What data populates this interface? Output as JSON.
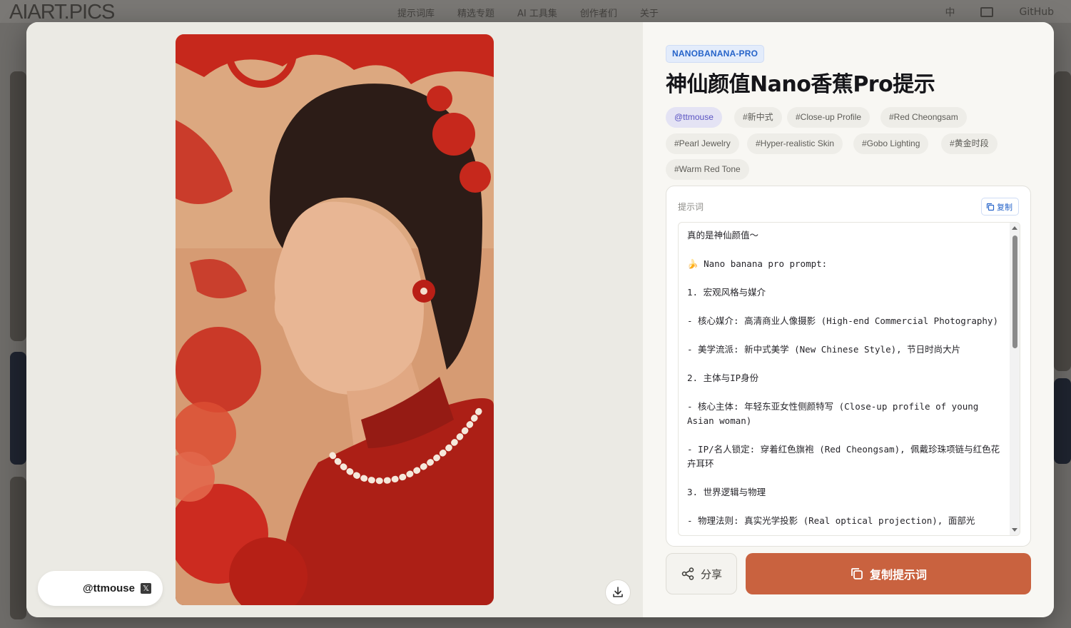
{
  "background": {
    "logo": "AIART.PICS",
    "nav": [
      "提示词库",
      "精选专题",
      "AI 工具集",
      "创作者们",
      "关于"
    ],
    "lang": "中",
    "github": "GitHub"
  },
  "modal": {
    "author_handle": "@ttmouse",
    "x_icon": "x-logo",
    "category": "NANOBANANA-PRO",
    "title": "神仙颜值Nano香蕉Pro提示",
    "tags": [
      "@ttmouse",
      "#新中式",
      "#Close-up Profile",
      "#Red Cheongsam",
      "#Pearl Jewelry",
      "#Hyper-realistic Skin",
      "#Gobo Lighting",
      "#黄金时段",
      "#Warm Red Tone"
    ],
    "prompt": {
      "label": "提示词",
      "copy_label": "复制",
      "text": "真的是神仙颜值～\n\n🍌 Nano banana pro prompt:\n\n1. 宏观风格与媒介\n\n- 核心媒介: 高清商业人像摄影 (High-end Commercial Photography)\n\n- 美学流派: 新中式美学 (New Chinese Style), 节日时尚大片\n\n2. 主体与IP身份\n\n- 核心主体: 年轻东亚女性侧颜特写 (Close-up profile of young Asian woman)\n\n- IP/名人锁定: 穿着红色旗袍 (Red Cheongsam), 佩戴珍珠项链与红色花卉耳环\n\n3. 世界逻辑与物理\n\n- 物理法则: 真实光学投影 (Real optical projection), 面部光"
    },
    "share_label": "分享",
    "copy_prompt_label": "复制提示词"
  },
  "colors": {
    "accent": "#c9623f",
    "badge_blue": "#2563c9",
    "author_tag": "#5a53c2"
  }
}
